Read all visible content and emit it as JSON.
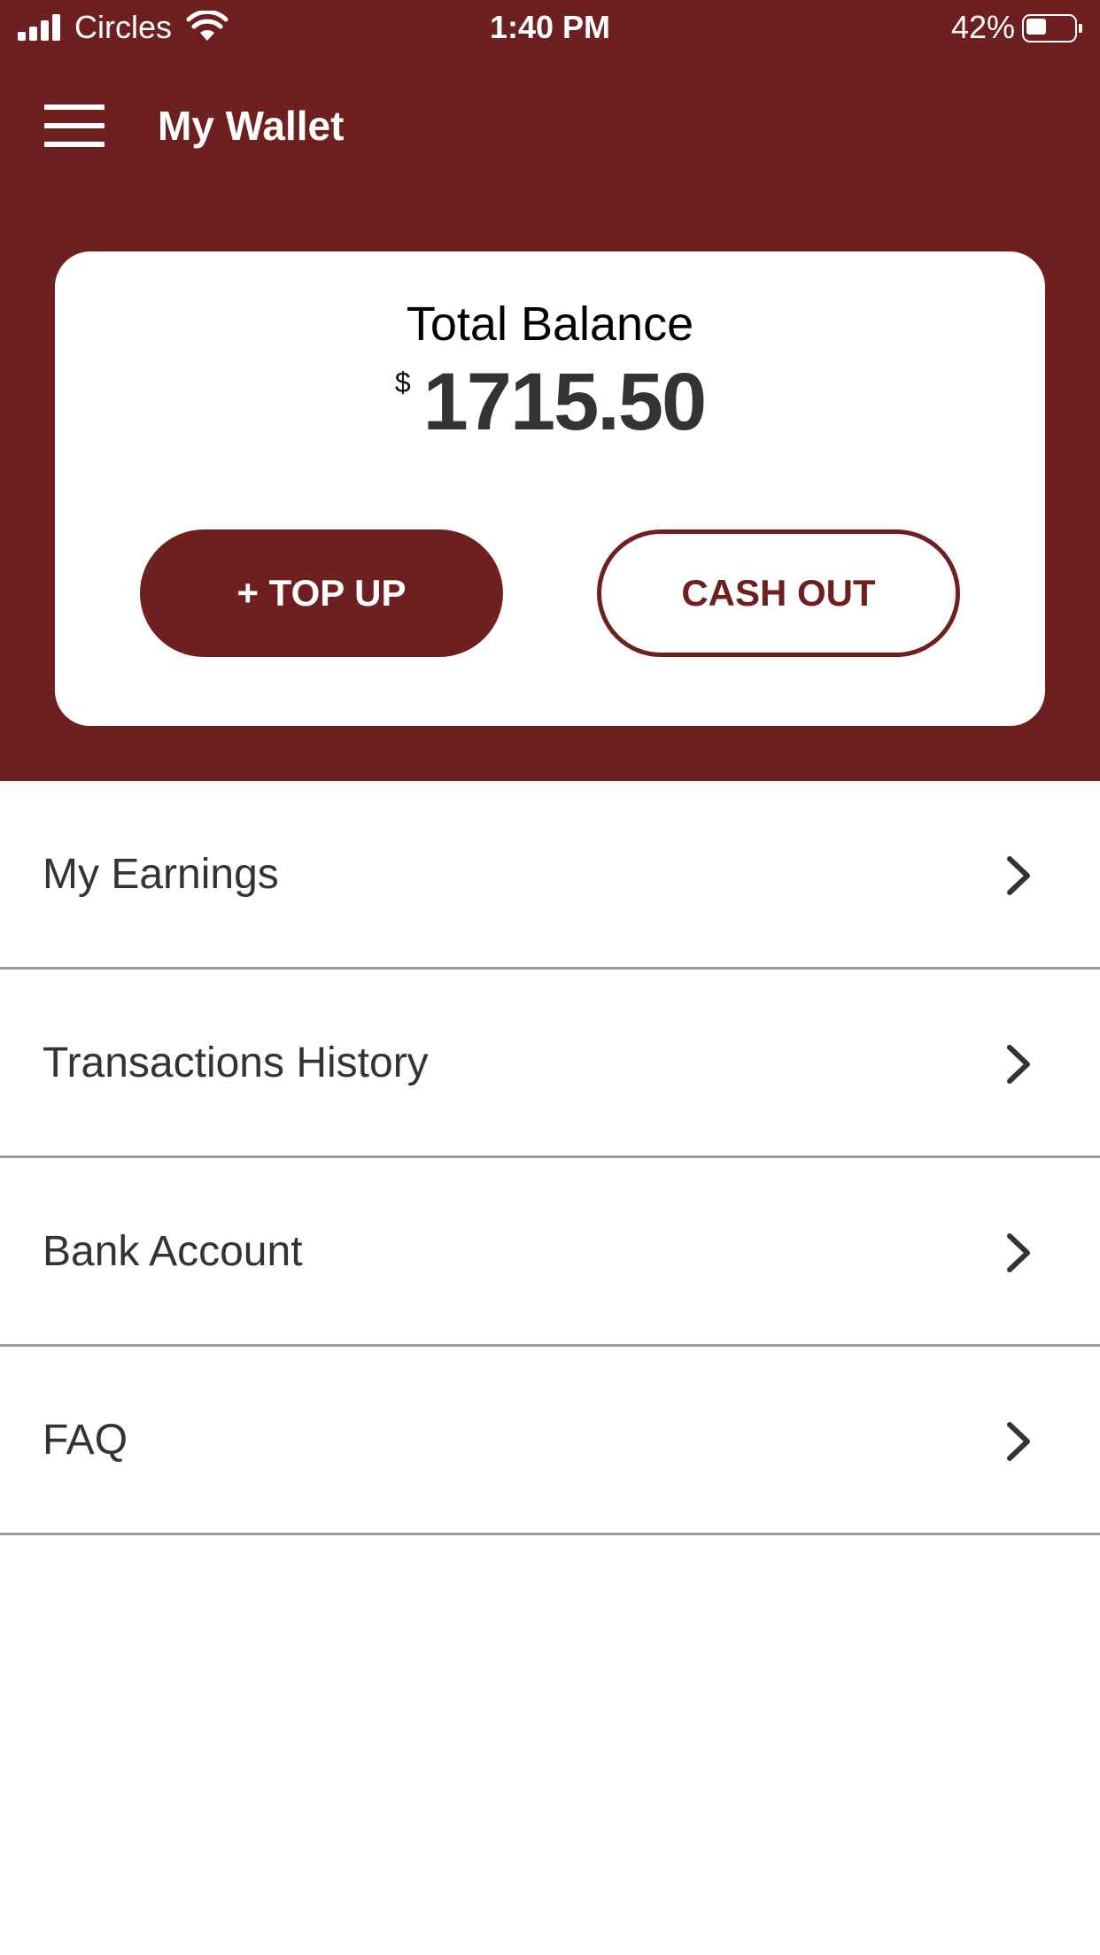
{
  "status_bar": {
    "carrier": "Circles",
    "time": "1:40 PM",
    "battery_percent": "42%",
    "battery_level": 0.42,
    "signal_icon": "signal-bars-icon",
    "wifi_icon": "wifi-icon",
    "battery_icon": "battery-icon"
  },
  "header": {
    "menu_icon": "hamburger-menu-icon",
    "title": "My Wallet"
  },
  "balance_card": {
    "label": "Total Balance",
    "currency": "$",
    "amount": "1715.50",
    "top_up_label": "+ TOP UP",
    "cash_out_label": "CASH OUT"
  },
  "menu": {
    "items": [
      {
        "label": "My Earnings",
        "icon": "chevron-right-icon"
      },
      {
        "label": "Transactions History",
        "icon": "chevron-right-icon"
      },
      {
        "label": "Bank Account",
        "icon": "chevron-right-icon"
      },
      {
        "label": "FAQ",
        "icon": "chevron-right-icon"
      }
    ]
  },
  "colors": {
    "brand": "#6e2020",
    "text_dark": "#333333",
    "divider": "#9a9a9a",
    "background": "#ffffff"
  }
}
